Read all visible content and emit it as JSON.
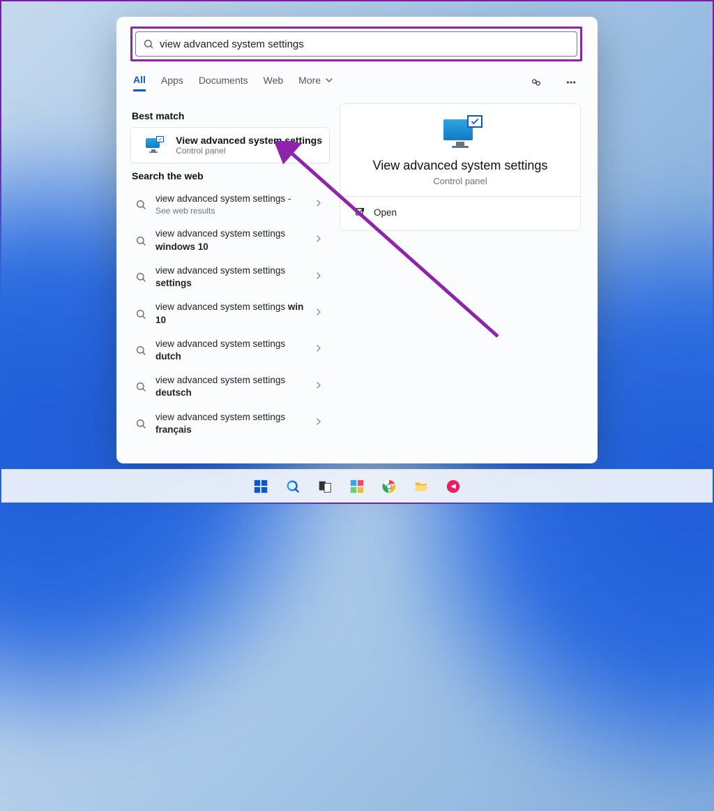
{
  "search": {
    "value": "view advanced system settings"
  },
  "tabs": {
    "all": "All",
    "apps": "Apps",
    "documents": "Documents",
    "web": "Web",
    "more": "More"
  },
  "sections": {
    "best_match": "Best match",
    "search_web": "Search the web"
  },
  "best_match": {
    "title": "View advanced system settings",
    "subtitle": "Control panel"
  },
  "web_results": [
    {
      "prefix": "view advanced system settings",
      "bold": "",
      "suffix": " -",
      "sub": "See web results"
    },
    {
      "prefix": "view advanced system settings ",
      "bold": "windows 10",
      "suffix": "",
      "sub": ""
    },
    {
      "prefix": "view advanced system settings ",
      "bold": "settings",
      "suffix": "",
      "sub": ""
    },
    {
      "prefix": "view advanced system settings ",
      "bold": "win 10",
      "suffix": "",
      "sub": ""
    },
    {
      "prefix": "view advanced system settings ",
      "bold": "dutch",
      "suffix": "",
      "sub": ""
    },
    {
      "prefix": "view advanced system settings ",
      "bold": "deutsch",
      "suffix": "",
      "sub": ""
    },
    {
      "prefix": "view advanced system settings ",
      "bold": "français",
      "suffix": "",
      "sub": ""
    }
  ],
  "detail": {
    "title": "View advanced system settings",
    "subtitle": "Control panel",
    "open": "Open"
  }
}
